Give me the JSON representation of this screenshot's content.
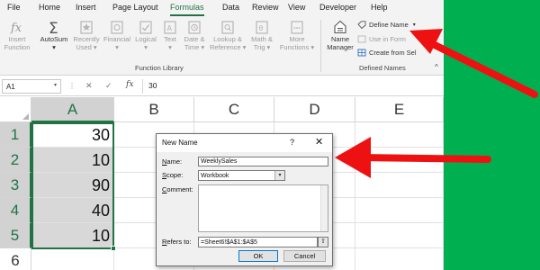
{
  "menu": {
    "tabs": [
      {
        "label": "File"
      },
      {
        "label": "Home"
      },
      {
        "label": "Insert"
      },
      {
        "label": "Page Layout"
      },
      {
        "label": "Formulas"
      },
      {
        "label": "Data"
      },
      {
        "label": "Review"
      },
      {
        "label": "View"
      },
      {
        "label": "Developer"
      },
      {
        "label": "Help"
      }
    ],
    "active_tab": "Formulas"
  },
  "ribbon": {
    "insert_function": {
      "line1": "Insert",
      "line2": "Function"
    },
    "autosum": {
      "line1": "AutoSum",
      "line2": "▾"
    },
    "recently_used": {
      "line1": "Recently",
      "line2": "Used ▾"
    },
    "financial": {
      "line1": "Financial",
      "line2": "▾"
    },
    "logical": {
      "line1": "Logical",
      "line2": "▾"
    },
    "text": {
      "line1": "Text",
      "line2": "▾"
    },
    "date_time": {
      "line1": "Date &",
      "line2": "Time ▾"
    },
    "lookup_reference": {
      "line1": "Lookup &",
      "line2": "Reference ▾"
    },
    "math_trig": {
      "line1": "Math &",
      "line2": "Trig ▾"
    },
    "more_functions": {
      "line1": "More",
      "line2": "Functions ▾"
    },
    "function_library_label": "Function Library",
    "name_manager": {
      "line1": "Name",
      "line2": "Manager"
    },
    "define_name": "Define Name",
    "define_name_chevron": "▾",
    "use_in_formula": "Use in Form",
    "create_from_selection": "Create from Sel",
    "defined_names_label": "Defined Names",
    "collapse_chevron": "^"
  },
  "formula_bar": {
    "name_box": "A1",
    "name_box_arrow": "▾",
    "dots": "⋮",
    "cancel_glyph": "✕",
    "enter_glyph": "✓",
    "fx_glyph": "fx",
    "value": "30"
  },
  "grid": {
    "columns": [
      "A",
      "B",
      "C",
      "D",
      "E"
    ],
    "rows": [
      "1",
      "2",
      "3",
      "4",
      "5",
      "6"
    ],
    "column_a_values": [
      "30",
      "10",
      "90",
      "40",
      "10",
      ""
    ]
  },
  "dialog": {
    "title": "New Name",
    "help_glyph": "?",
    "close_glyph": "✕",
    "name_label_key": "N",
    "name_label_rest": "ame:",
    "name_value": "WeeklySales",
    "scope_label_key": "S",
    "scope_label_rest": "cope:",
    "scope_value": "Workbook",
    "scope_arrow": "▾",
    "comment_label_key": "C",
    "comment_label_rest": "omment:",
    "refers_label_key": "R",
    "refers_label_rest": "efers to:",
    "refers_value": "=Sheet6!$A$1:$A$5",
    "refers_button_glyph": "⇧",
    "ok_label": "OK",
    "cancel_label": "Cancel"
  },
  "colors": {
    "excel_green": "#217346",
    "background_green": "#00b050",
    "arrow_red": "#ee1111"
  }
}
